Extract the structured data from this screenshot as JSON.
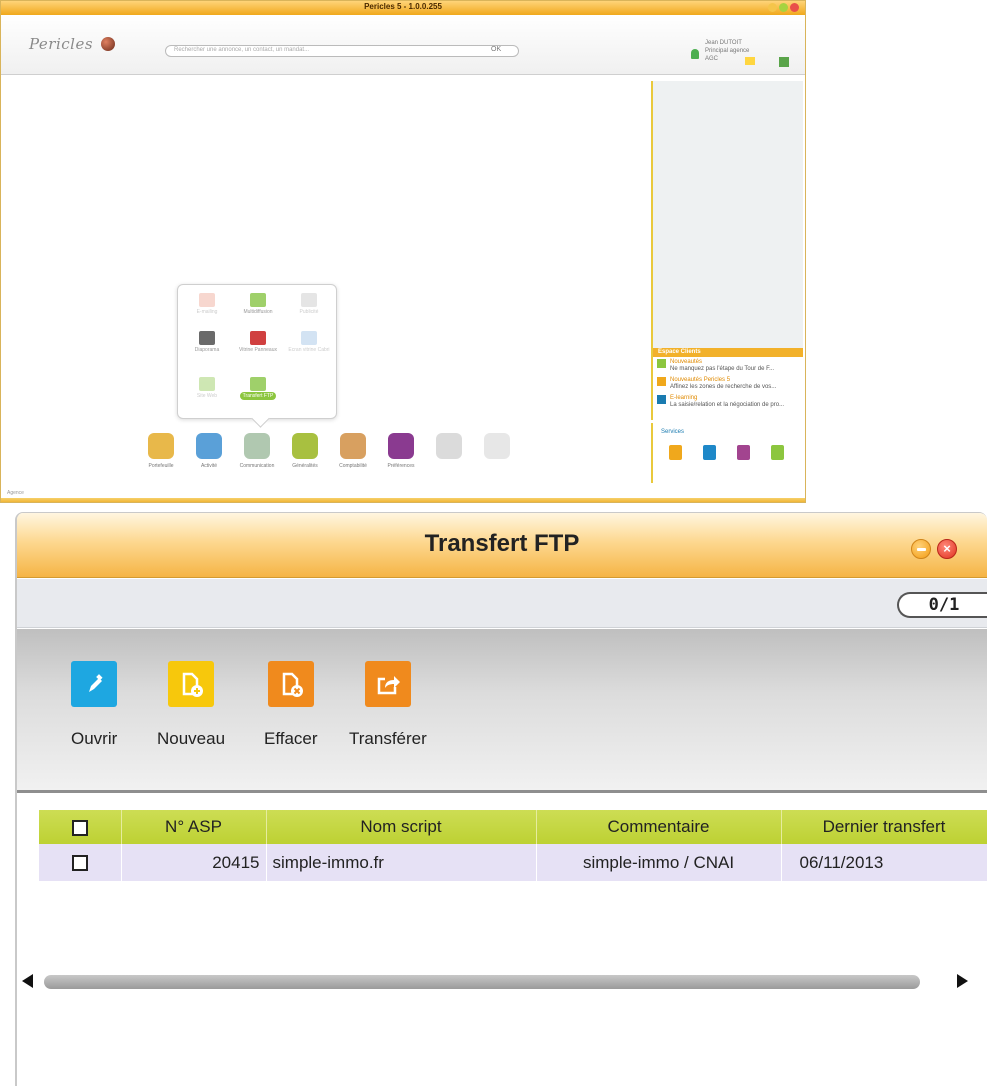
{
  "app": {
    "title": "Pericles 5 - 1.0.0.255",
    "logo_text": "Pericles",
    "search_placeholder": "Rechercher une annonce, un contact, un mandat...",
    "search_button": "OK",
    "user_lines": [
      "Jean DUTOIT",
      "Principal agence",
      "AGC"
    ],
    "status": "Agence",
    "news": {
      "title": "Espace Clients",
      "items": [
        {
          "title": "Nouveautés",
          "text": "Ne manquez pas l'étape du Tour de F..."
        },
        {
          "title": "Nouveautés Pericles 5",
          "text": "Affinez les zones de recherche de vos..."
        },
        {
          "title": "E-learning",
          "text": "La saisie/relation et la négociation de pro..."
        }
      ]
    },
    "services_label": "Services",
    "popup_items": [
      {
        "label": "E-mailing"
      },
      {
        "label": "Multidiffusion"
      },
      {
        "label": "Publicité"
      },
      {
        "label": "Diaporama"
      },
      {
        "label": "Vitrine Panneaux"
      },
      {
        "label": "Ecran vitrine Cabri"
      },
      {
        "label": "Site Web"
      },
      {
        "label": "Transfert FTP"
      }
    ],
    "dock_items": [
      {
        "label": "Portefeuille"
      },
      {
        "label": "Activité"
      },
      {
        "label": "Communication"
      },
      {
        "label": "Généralités"
      },
      {
        "label": "Comptabilité"
      },
      {
        "label": "Préférences"
      },
      {
        "label": ""
      },
      {
        "label": ""
      }
    ],
    "colors": {
      "accent": "#f0a81c",
      "green": "#8cc63f"
    }
  },
  "ftp": {
    "title": "Transfert FTP",
    "counter": "0/1",
    "close_glyph": "×",
    "toolbar": [
      {
        "label": "Ouvrir",
        "icon": "pencil-icon",
        "color": "#1ea7e1"
      },
      {
        "label": "Nouveau",
        "icon": "new-document-icon",
        "color": "#f7c80c"
      },
      {
        "label": "Effacer",
        "icon": "delete-document-icon",
        "color": "#f08a1d"
      },
      {
        "label": "Transférer",
        "icon": "transfer-icon",
        "color": "#f08a1d"
      }
    ],
    "table": {
      "columns": [
        "N° ASP",
        "Nom script",
        "Commentaire",
        "Dernier transfert"
      ],
      "rows": [
        {
          "asp": "20415",
          "script": "simple-immo.fr",
          "comment": "simple-immo / CNAI",
          "last": "06/11/2013"
        }
      ]
    }
  }
}
